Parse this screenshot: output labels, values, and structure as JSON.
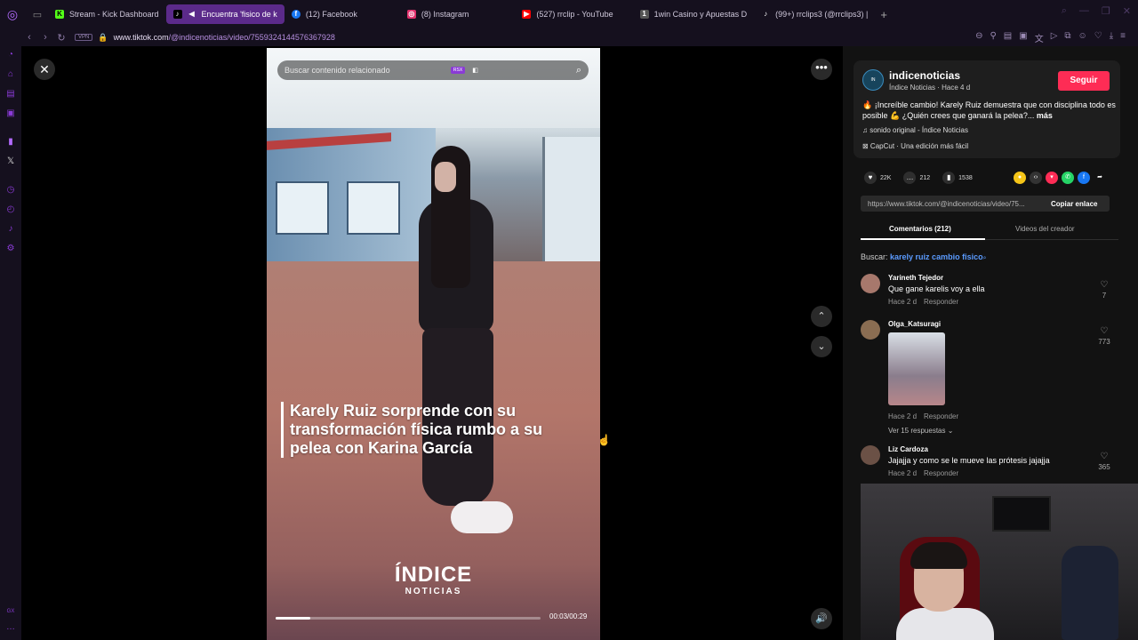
{
  "browser": {
    "tabs": [
      {
        "label": "Stream - Kick Dashboard",
        "color": "#53fc18",
        "glyph": "K"
      },
      {
        "label": "Encuentra 'fisico de k",
        "color": "#ffffff",
        "glyph": "♪"
      },
      {
        "label": "(12) Facebook",
        "color": "#1877f2",
        "glyph": "f"
      },
      {
        "label": "(8) Instagram",
        "color": "#e1306c",
        "glyph": "◎"
      },
      {
        "label": "(527) rrclip - YouTube",
        "color": "#ff0000",
        "glyph": "▶"
      },
      {
        "label": "1win Casino y Apuestas D",
        "color": "#555555",
        "glyph": "1"
      },
      {
        "label": "(99+) rrclips3 (@rrclips3) |",
        "color": "#ffffff",
        "glyph": "♪"
      }
    ],
    "url_prefix": "www.tiktok.com",
    "url_rest": "/@indicenoticias/video/7559324144576367928",
    "vpn_label": "VPN"
  },
  "video": {
    "search_placeholder": "Buscar contenido relacionado",
    "rsx_badge": "RSX",
    "caption": "Karely Ruiz sorprende con su transformación física rumbo a su pelea con Karina García",
    "brand_big": "ÍNDICE",
    "brand_small": "NOTICIAS",
    "timecode": "00:03/00:29",
    "progress": 0.13
  },
  "post": {
    "username": "indicenoticias",
    "subline": "Índice Noticias · Hace 4 d",
    "follow_label": "Seguir",
    "description": "🔥 ¡Increíble cambio! Karely Ruiz demuestra que con disciplina todo es posible 💪 ¿Quién crees que ganará la pelea?...",
    "more_label": "más",
    "music": "♫  sonido original - Índice Noticias",
    "capcut": "⊠  CapCut · Una edición más fácil",
    "likes": "22K",
    "comments": "212",
    "saves": "1538",
    "link": "https://www.tiktok.com/@indicenoticias/video/75...",
    "copy_label": "Copiar enlace",
    "tab_comments": "Comentarios (212)",
    "tab_creator": "Videos del creador",
    "search_prefix": "Buscar:",
    "search_term": "karely ruiz cambio fisico"
  },
  "comments": [
    {
      "user": "Yarineth Tejedor",
      "text": "Que gane karelis voy a ella",
      "meta": "Hace 2 d",
      "reply": "Responder",
      "likes": "7"
    },
    {
      "user": "Olga_Katsuragi",
      "text": "",
      "meta": "Hace 2 d",
      "reply": "Responder",
      "likes": "773",
      "replies_label": "Ver 15 respuestas ⌄"
    },
    {
      "user": "Liz Cardoza",
      "text": "Jajajja y como se le mueve las prótesis jajajja",
      "meta": "Hace 2 d",
      "reply": "Responder",
      "likes": "365"
    }
  ]
}
